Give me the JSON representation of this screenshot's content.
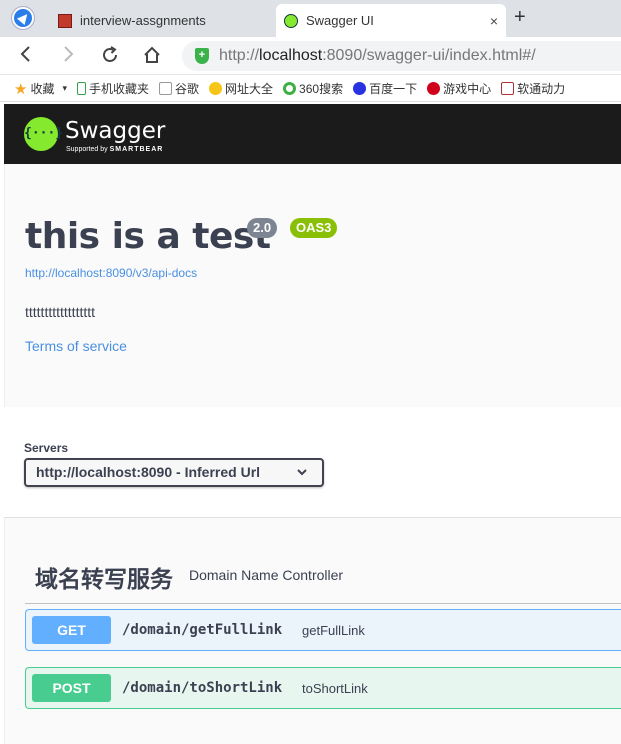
{
  "browser": {
    "tabs": [
      {
        "title": "interview-assgnments",
        "active": false
      },
      {
        "title": "Swagger UI",
        "active": true
      }
    ],
    "close_icon": "×",
    "new_tab_icon": "+",
    "url_prefix": "http://",
    "url_host": "localhost",
    "url_rest": ":8090/swagger-ui/index.html#/",
    "bookmarks": [
      {
        "label": "收藏",
        "icon": "star-icon"
      },
      {
        "label": "手机收藏夹",
        "icon": "phone-icon"
      },
      {
        "label": "谷歌",
        "icon": "document-icon"
      },
      {
        "label": "网址大全",
        "icon": "globe-icon"
      },
      {
        "label": "360搜索",
        "icon": "search-360-icon"
      },
      {
        "label": "百度一下",
        "icon": "baidu-icon"
      },
      {
        "label": "游戏中心",
        "icon": "game-icon"
      },
      {
        "label": "软通动力",
        "icon": "psd-icon"
      }
    ]
  },
  "swagger": {
    "brand": "Swagger",
    "logo_glyph": "{···}",
    "supported_by": "Supported by",
    "smartbear": "SMARTBEAR",
    "info": {
      "title": "this is a test",
      "version": "2.0",
      "oas": "OAS3",
      "spec_url": "http://localhost:8090/v3/api-docs",
      "description": "tttttttttttttttttt",
      "terms": "Terms of service"
    },
    "servers": {
      "label": "Servers",
      "selected": "http://localhost:8090 - Inferred Url"
    },
    "tag": {
      "name": "域名转写服务",
      "description": "Domain Name Controller"
    },
    "operations": [
      {
        "method": "GET",
        "path": "/domain/getFullLink",
        "summary": "getFullLink"
      },
      {
        "method": "POST",
        "path": "/domain/toShortLink",
        "summary": "toShortLink"
      }
    ]
  },
  "colors": {
    "get": "#61affe",
    "post": "#49cc90",
    "oas_badge": "#89bf04",
    "version_badge": "#7d8492",
    "link": "#4990e2"
  }
}
